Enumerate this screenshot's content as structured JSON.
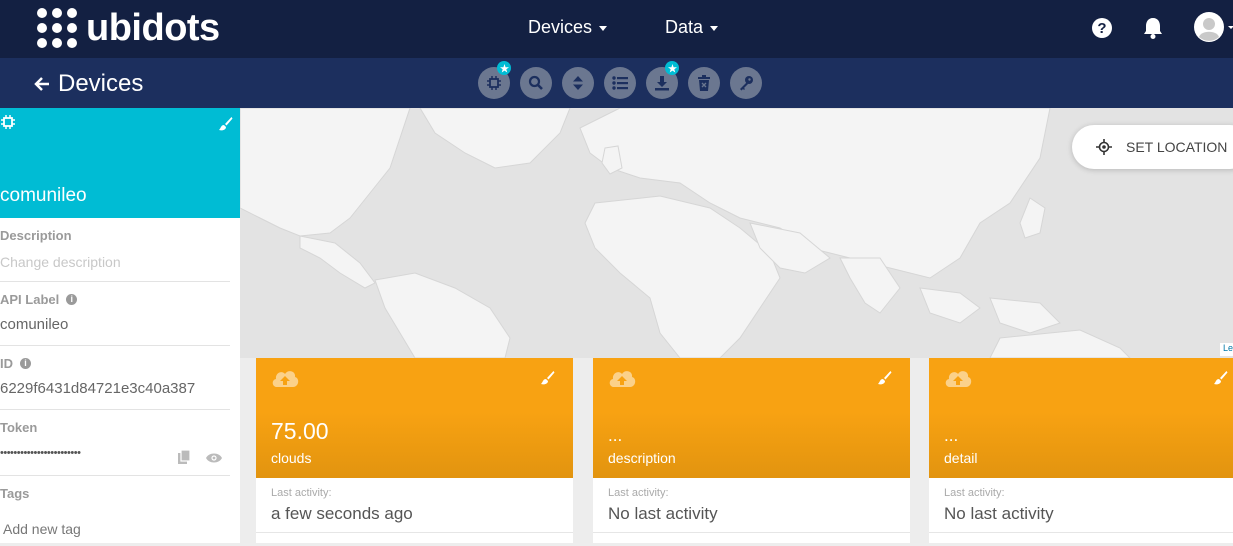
{
  "brand": {
    "name": "ubidots"
  },
  "nav": {
    "devices": "Devices",
    "data": "Data"
  },
  "page": {
    "title": "Devices"
  },
  "toolbar": {
    "items": [
      "device-icon",
      "search-icon",
      "sort-icon",
      "list-icon",
      "download-icon",
      "delete-icon",
      "key-icon"
    ]
  },
  "device": {
    "name": "comunileo",
    "description_label": "Description",
    "description_placeholder": "Change description",
    "api_label_label": "API Label",
    "api_label": "comunileo",
    "id_label": "ID",
    "id": "6229f6431d84721e3c40a387",
    "token_label": "Token",
    "token_masked": "••••••••••••••••••••••••",
    "tags_label": "Tags",
    "tags_placeholder": "Add new tag"
  },
  "map": {
    "set_location": "SET LOCATION",
    "attribution": "Le"
  },
  "cards": [
    {
      "value": "75.00",
      "name": "clouds",
      "last_activity_label": "Last activity:",
      "last_activity": "a few seconds ago"
    },
    {
      "value": "...",
      "name": "description",
      "last_activity_label": "Last activity:",
      "last_activity": "No last activity"
    },
    {
      "value": "...",
      "name": "detail",
      "last_activity_label": "Last activity:",
      "last_activity": "No last activity"
    }
  ],
  "colors": {
    "nav": "#132042",
    "subbar": "#1c2f5e",
    "device_header": "#00bcd4",
    "card": "#f8a212"
  }
}
